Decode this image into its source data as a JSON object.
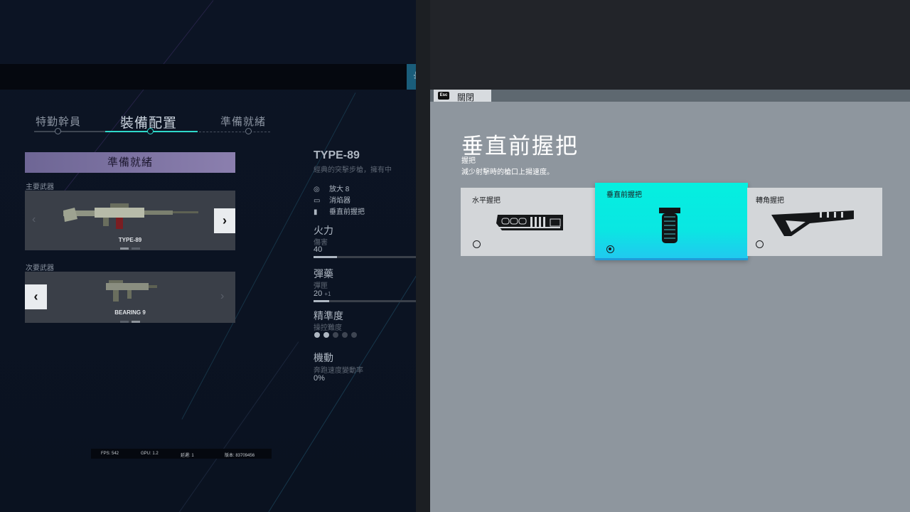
{
  "operator_tabs": [
    {
      "label": "特勤幹員",
      "active": false
    },
    {
      "label": "裝備配置",
      "active": true
    },
    {
      "label": "準備就緒",
      "active": false
    }
  ],
  "ready_banner": "準備就緒",
  "primary": {
    "section": "主要武器",
    "name": "TYPE-89"
  },
  "secondary": {
    "section": "次要武器",
    "name": "BEARING 9"
  },
  "weapon_info": {
    "name": "TYPE-89",
    "description": "經典的突擊步槍，擁有中",
    "attachments": [
      {
        "icon": "scope-icon",
        "label": "放大 8"
      },
      {
        "icon": "suppressor-icon",
        "label": "消焰器"
      },
      {
        "icon": "grip-icon",
        "label": "垂直前握把"
      }
    ],
    "stats": {
      "firepower": {
        "title": "火力",
        "sub": "傷害",
        "value": "40",
        "level": 0.23
      },
      "ammo": {
        "title": "彈藥",
        "sub": "彈匣",
        "value": "20",
        "extra": "+1",
        "level": 0.15
      },
      "accuracy": {
        "title": "精準度",
        "sub": "操控難度",
        "dots_total": 5,
        "dots_filled": 2
      },
      "mobility": {
        "title": "機動",
        "sub": "奔跑速度變動率",
        "value": "0%"
      }
    }
  },
  "perf": {
    "fps": "FPS: 542",
    "gpu": "GPU: 1.2",
    "latency": "延遲: 1",
    "version": "版本: 83709456"
  },
  "overlay": {
    "esc": "Esc",
    "close": "關閉",
    "title": "垂直前握把",
    "category": "握把",
    "description": "減少射擊時的槍口上揚速度。",
    "options": [
      {
        "name": "水平握把",
        "icon": "horizontal-grip-icon",
        "selected": false
      },
      {
        "name": "垂直前握把",
        "icon": "vertical-grip-icon",
        "selected": true
      },
      {
        "name": "轉角握把",
        "icon": "angled-grip-icon",
        "selected": false
      }
    ]
  },
  "colors": {
    "accent_cyan": "#05efe0",
    "ready_purple": "#8b7fae",
    "panel_gray": "#8e969e"
  }
}
